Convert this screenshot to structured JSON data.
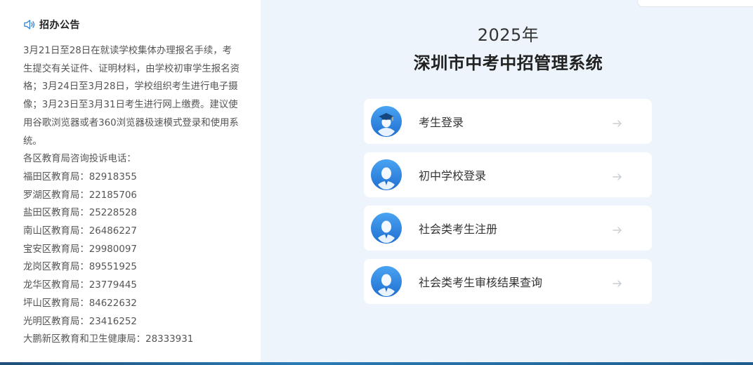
{
  "notice": {
    "title": "招办公告",
    "icon": "speaker-icon",
    "paragraph": "3月21日至28日在就读学校集体办理报名手续，考生提交有关证件、证明材料，由学校初审学生报名资格；3月24日至3月28日，学校组织考生进行电子摄像；3月23日至3月31日考生进行网上缴费。建议使用谷歌浏览器或者360浏览器极速模式登录和使用系统。",
    "contacts_header": "各区教育局咨询投诉电话：",
    "contacts": [
      "福田区教育局：82918355",
      "罗湖区教育局：22185706",
      "盐田区教育局：25228528",
      "南山区教育局：26486227",
      "宝安区教育局：29980097",
      "龙岗区教育局：89551925",
      "龙华区教育局：23779445",
      "坪山区教育局：84622632",
      "光明区教育局：23416252",
      "大鹏新区教育和卫生健康局：28333931"
    ]
  },
  "header": {
    "year": "2025年",
    "title": "深圳市中考中招管理系统"
  },
  "menu": [
    {
      "label": "考生登录",
      "icon": "graduate-avatar-icon"
    },
    {
      "label": "初中学校登录",
      "icon": "user-avatar-icon"
    },
    {
      "label": "社会类考生注册",
      "icon": "user-avatar-icon"
    },
    {
      "label": "社会类考生审核结果查询",
      "icon": "user-avatar-icon"
    }
  ],
  "colors": {
    "accent": "#2f7fd6",
    "background": "#eef4fb",
    "panel": "#ffffff",
    "text": "#333333",
    "arrow": "#c9ced6"
  }
}
